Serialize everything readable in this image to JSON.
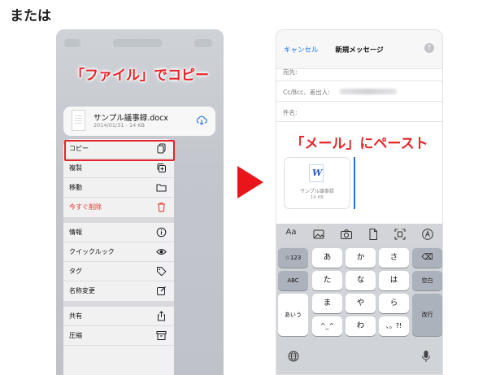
{
  "heading": "または",
  "left": {
    "callout": "「ファイル」でコピー",
    "file": {
      "name": "サンプル議事録.docx",
      "meta": "2014/01/31 - 14 KB"
    },
    "menu": {
      "copy": "コピー",
      "duplicate": "複製",
      "move": "移動",
      "delete": "今すぐ削除",
      "info": "情報",
      "quicklook": "クイックルック",
      "tags": "タグ",
      "rename": "名称変更",
      "share": "共有",
      "compress": "圧縮"
    }
  },
  "right": {
    "nav": {
      "cancel": "キャンセル",
      "title": "新規メッセージ"
    },
    "fields": {
      "to": "宛先:",
      "cc": "Cc/Bcc、差出人:",
      "subject": "件名:"
    },
    "callout": "「メール」にペースト",
    "attachment": {
      "name": "サンプル議事録",
      "size": "14 KB"
    },
    "toolbar": {
      "aa": "Aa"
    },
    "keys": {
      "numbers": "☆123",
      "a": "あ",
      "ka": "か",
      "sa": "さ",
      "abc": "ABC",
      "ta": "た",
      "na": "な",
      "ha": "は",
      "space": "空白",
      "aiu": "あいう",
      "ma": "ま",
      "ya": "や",
      "ra": "ら",
      "return": "改行",
      "emoticon": "^_^",
      "wa": "わ",
      "punct": "、。?!"
    }
  },
  "colors": {
    "accent_red": "#e3242b",
    "link_blue": "#1a73e8"
  }
}
